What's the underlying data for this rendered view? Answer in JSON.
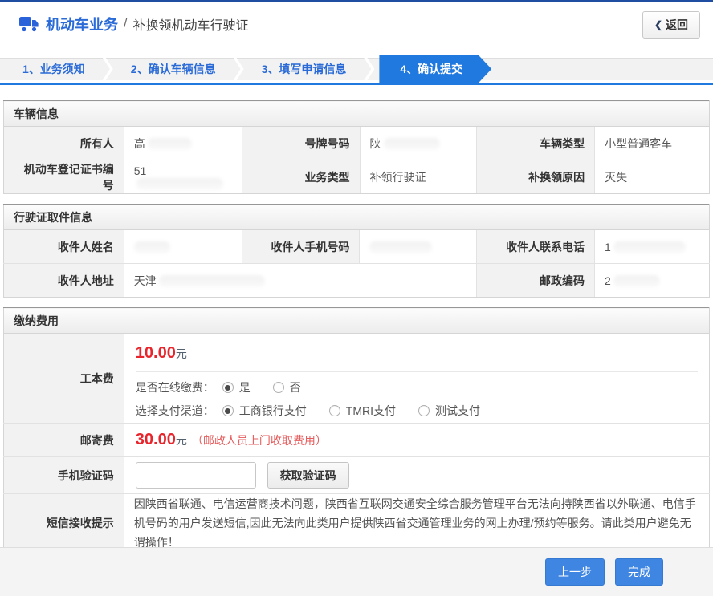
{
  "header": {
    "title": "机动车业务",
    "separator": "/",
    "subtitle": "补换领机动车行驶证",
    "back_chevron": "❮",
    "back_label": "返回"
  },
  "steps": [
    {
      "label": "1、业务须知"
    },
    {
      "label": "2、确认车辆信息"
    },
    {
      "label": "3、填写申请信息"
    },
    {
      "label": "4、确认提交"
    }
  ],
  "vehicle_section": {
    "title": "车辆信息",
    "owner_label": "所有人",
    "owner_value": "高",
    "plate_label": "号牌号码",
    "plate_value": "陕",
    "vehicle_type_label": "车辆类型",
    "vehicle_type_value": "小型普通客车",
    "cert_no_label": "机动车登记证书编号",
    "cert_no_value": "51",
    "business_type_label": "业务类型",
    "business_type_value": "补领行驶证",
    "reason_label": "补换领原因",
    "reason_value": "灭失"
  },
  "pickup_section": {
    "title": "行驶证取件信息",
    "recipient_name_label": "收件人姓名",
    "recipient_mobile_label": "收件人手机号码",
    "recipient_phone_label": "收件人联系电话",
    "recipient_phone_value": "1",
    "recipient_address_label": "收件人地址",
    "recipient_address_value": "天津",
    "postcode_label": "邮政编码",
    "postcode_value": "2"
  },
  "fees_section": {
    "title": "缴纳费用",
    "production_fee_label": "工本费",
    "production_fee_amount": "10.00",
    "currency": "元",
    "online_pay_label": "是否在线缴费：",
    "online_pay_yes": "是",
    "online_pay_no": "否",
    "channel_label": "选择支付渠道：",
    "channel_options": [
      "工商银行支付",
      "TMRI支付",
      "测试支付"
    ],
    "postage_label": "邮寄费",
    "postage_amount": "30.00",
    "postage_note": "（邮政人员上门收取费用）",
    "sms_code_label": "手机验证码",
    "get_code_button": "获取验证码",
    "sms_tip_label": "短信接收提示",
    "sms_tip": "因陕西省联通、电信运营商技术问题，陕西省互联网交通安全综合服务管理平台无法向持陕西省以外联通、电信手机号码的用户发送短信,因此无法向此类用户提供陕西省交通管理业务的网上办理/预约等服务。请此类用户避免无谓操作！"
  },
  "footer": {
    "prev_label": "上一步",
    "done_label": "完成"
  },
  "colors": {
    "accent_blue": "#2079df",
    "title_blue": "#2b6bd7",
    "price_red": "#e8252c",
    "warning_red": "#e06a6a",
    "top_strip_blue": "#1f4da1"
  }
}
